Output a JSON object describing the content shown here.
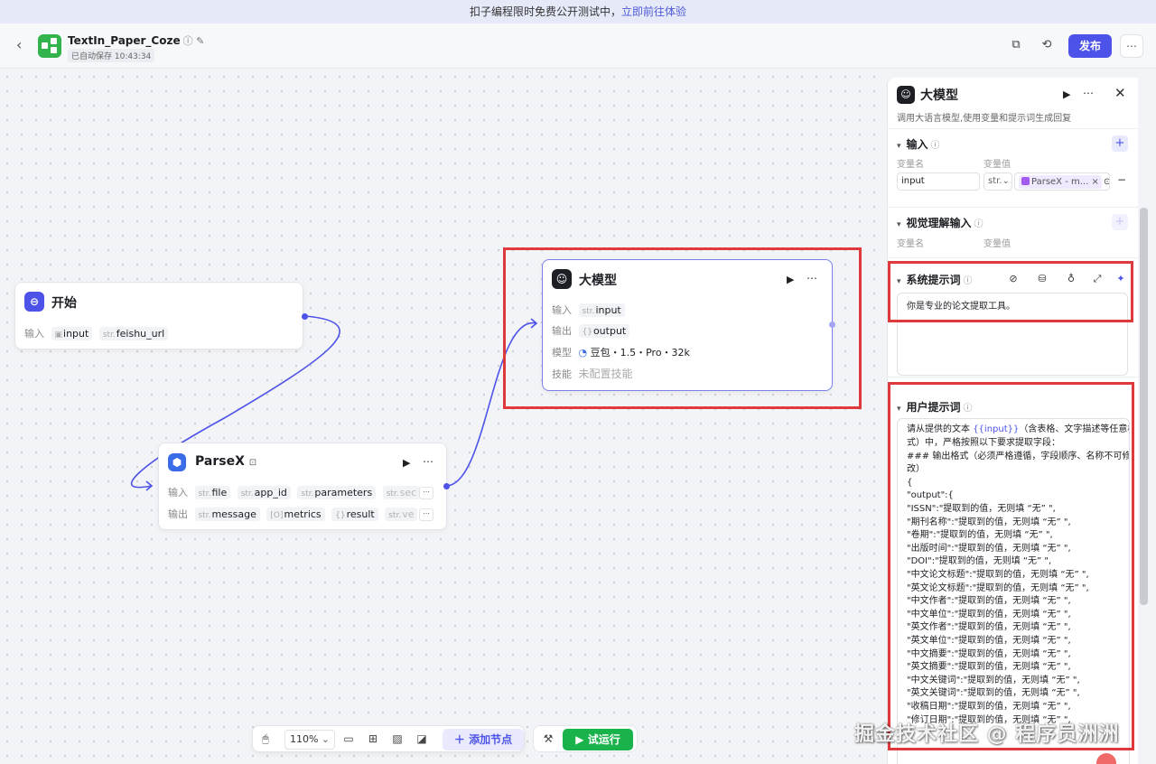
{
  "banner": {
    "text": "扣子编程限时免费公开测试中，",
    "link": "立即前往体验"
  },
  "header": {
    "back": "‹",
    "title": "TextIn_Paper_Coze",
    "title_icons": "ⓘ ✎",
    "saved": "已自动保存 10:43:34",
    "publish": "发布",
    "more": "⋯"
  },
  "nodes": {
    "start": {
      "title": "开始",
      "input_label": "输入",
      "tags": [
        {
          "type": "",
          "name": "input"
        },
        {
          "type": "str.",
          "name": "feishu_url"
        }
      ]
    },
    "parsex": {
      "title": "ParseX",
      "input_label": "输入",
      "output_label": "输出",
      "inputs": [
        {
          "type": "str.",
          "name": "file"
        },
        {
          "type": "str.",
          "name": "app_id"
        },
        {
          "type": "str.",
          "name": "parameters"
        },
        {
          "type": "str.",
          "name": "sec"
        }
      ],
      "outputs": [
        {
          "type": "str.",
          "name": "message"
        },
        {
          "type": "[O]",
          "name": "metrics"
        },
        {
          "type": "{}",
          "name": "result"
        },
        {
          "type": "str.",
          "name": "ve"
        }
      ]
    },
    "llm": {
      "title": "大模型",
      "input_label": "输入",
      "input": {
        "type": "str.",
        "name": "input"
      },
      "output_label": "输出",
      "output": {
        "type": "{}",
        "name": "output"
      },
      "model_label": "模型",
      "model": "豆包・1.5・Pro・32k",
      "skill_label": "技能",
      "skill": "未配置技能"
    }
  },
  "toolbar": {
    "zoom": "110%",
    "add_node": "添加节点",
    "test_run": "试运行"
  },
  "panel": {
    "title": "大模型",
    "desc": "调用大语言模型,使用变量和提示词生成回复",
    "input_section": "输入",
    "col_name": "变量名",
    "col_value": "变量值",
    "input_name": "input",
    "input_type": "str.",
    "input_ref": "ParseX - m...",
    "vision_section": "视觉理解输入",
    "vision_col_name": "变量名",
    "vision_col_value": "变量值",
    "system_section": "系统提示词",
    "system_prompt": "你是专业的论文提取工具。",
    "user_section": "用户提示词",
    "user_prompt_intro_1": "请从提供的文本 ",
    "user_prompt_var": "{{input}}",
    "user_prompt_intro_2": "（含表格、文字描述等任意格",
    "user_prompt_lines": [
      "式）中，严格按照以下要求提取字段：",
      "### 输出格式（必须严格遵循，字段顺序、名称不可修",
      "改）",
      "{",
      "\"output\":{",
      "\"ISSN\":\"提取到的值，无则填 “无” \",",
      "\"期刊名称\":\"提取到的值，无则填 “无” \",",
      "\"卷期\":\"提取到的值，无则填 “无” \",",
      "\"出版时间\":\"提取到的值，无则填 “无” \",",
      "\"DOI\":\"提取到的值，无则填 “无” \",",
      "\"中文论文标题\":\"提取到的值，无则填 “无” \",",
      "\"英文论文标题\":\"提取到的值，无则填 “无” \",",
      "\"中文作者\":\"提取到的值，无则填 “无” \",",
      "\"中文单位\":\"提取到的值，无则填 “无” \",",
      "\"英文作者\":\"提取到的值，无则填 “无” \",",
      "\"英文单位\":\"提取到的值，无则填 “无” \",",
      "\"中文摘要\":\"提取到的值，无则填 “无” \",",
      "\"英文摘要\":\"提取到的值，无则填 “无” \",",
      "\"中文关键词\":\"提取到的值，无则填 “无” \",",
      "\"英文关键词\":\"提取到的值，无则填 “无” \",",
      "\"收稿日期\":\"提取到的值，无则填 “无” \",",
      "\"修订日期\":\"提取到的值，无则填 “无” \","
    ]
  },
  "watermark": "掘金技术社区 @ 程序员洲洲",
  "colors": {
    "accent": "#4d53e8",
    "run_green": "#1ab34b",
    "highlight_red": "#e0393b"
  }
}
